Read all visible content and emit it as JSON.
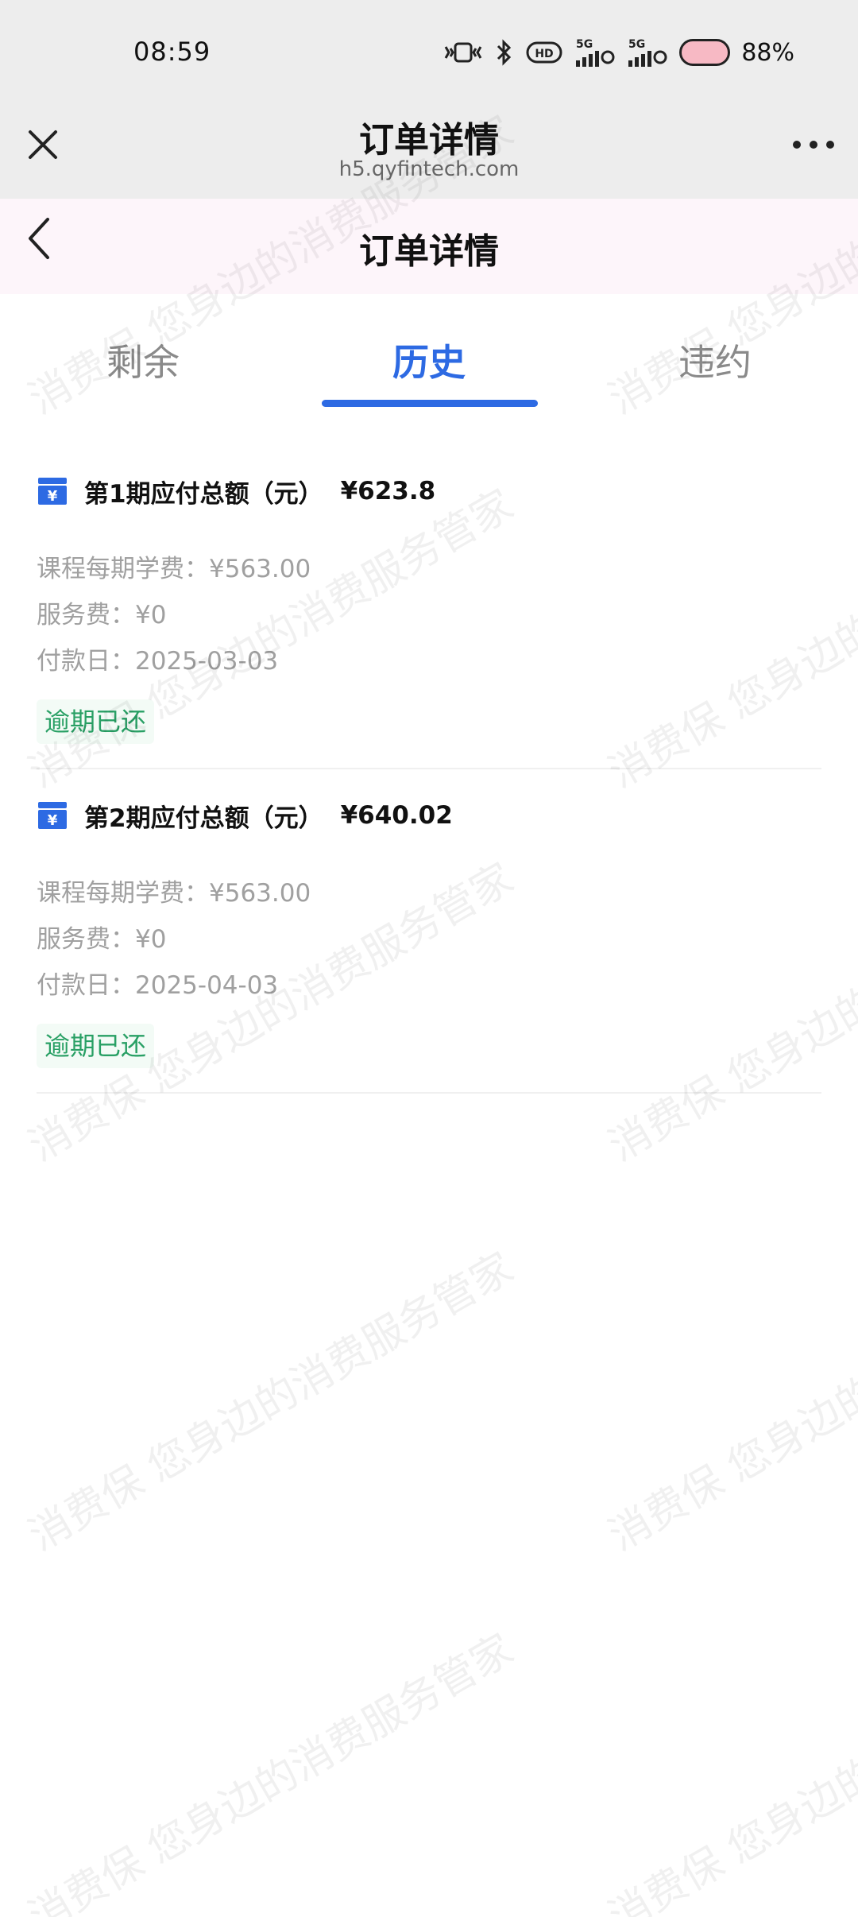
{
  "status_bar": {
    "time": "08:59",
    "network_1": "5G",
    "network_2": "5G",
    "hd": "HD",
    "battery": "88%"
  },
  "webview": {
    "title": "订单详情",
    "url": "h5.qyfintech.com"
  },
  "page": {
    "title": "订单详情"
  },
  "tabs": [
    {
      "label": "剩余",
      "active": false
    },
    {
      "label": "历史",
      "active": true
    },
    {
      "label": "违约",
      "active": false
    }
  ],
  "accent_color": "#2d6ae3",
  "status_color": "#29a065",
  "watermark": {
    "line_a": "消费保 您身边的消费服务管家"
  },
  "items": [
    {
      "title": "第1期应付总额（元）",
      "amount": "¥623.8",
      "tuition_label": "课程每期学费：",
      "tuition_value": "¥563.00",
      "fee_label": "服务费：",
      "fee_value": "¥0",
      "date_label": "付款日：",
      "date_value": "2025-03-03",
      "status": "逾期已还"
    },
    {
      "title": "第2期应付总额（元）",
      "amount": "¥640.02",
      "tuition_label": "课程每期学费：",
      "tuition_value": "¥563.00",
      "fee_label": "服务费：",
      "fee_value": "¥0",
      "date_label": "付款日：",
      "date_value": "2025-04-03",
      "status": "逾期已还"
    }
  ]
}
